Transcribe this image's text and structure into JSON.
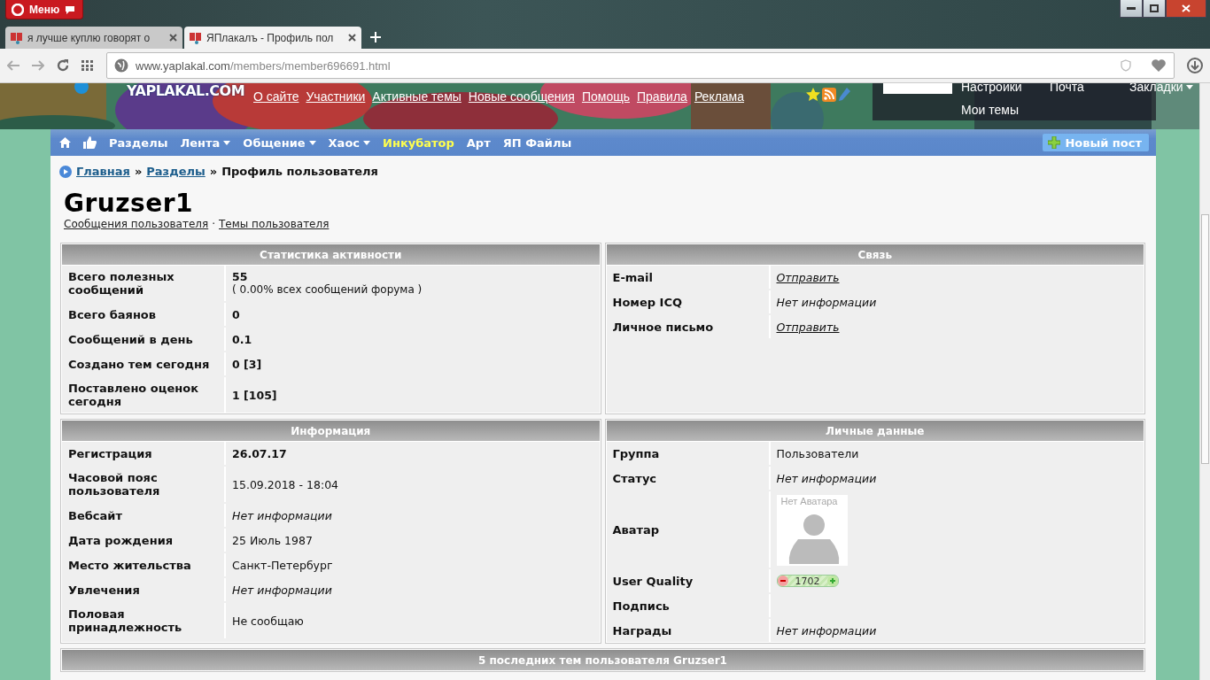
{
  "browser": {
    "menu": "Меню",
    "tabs": [
      {
        "title": "я лучше куплю говорят о",
        "selected": false
      },
      {
        "title": "ЯПлакалъ - Профиль пол",
        "selected": true
      }
    ],
    "url": {
      "host": "www.yaplakal.com",
      "path": "/members/member696691.html"
    }
  },
  "header": {
    "logo": "YAPLAKAL.COM",
    "links": [
      "О сайте",
      "Участники",
      "Активные темы",
      "Новые сообщения",
      "Помощь",
      "Правила",
      "Реклама"
    ],
    "user_menu": [
      {
        "label": "Настройки",
        "dropdown": false
      },
      {
        "label": "Почта",
        "dropdown": false
      },
      {
        "label": "Закладки",
        "dropdown": true
      },
      {
        "label": "Мои темы",
        "dropdown": false
      }
    ]
  },
  "nav": {
    "items": [
      {
        "label": "Разделы",
        "dropdown": false,
        "highlighted": false
      },
      {
        "label": "Лента",
        "dropdown": true,
        "highlighted": false
      },
      {
        "label": "Общение",
        "dropdown": true,
        "highlighted": false
      },
      {
        "label": "Хаос",
        "dropdown": true,
        "highlighted": false
      },
      {
        "label": "Инкубатор",
        "dropdown": false,
        "highlighted": true
      },
      {
        "label": "Арт",
        "dropdown": false,
        "highlighted": false
      },
      {
        "label": "ЯП Файлы",
        "dropdown": false,
        "highlighted": false
      }
    ],
    "new_post": "Новый пост"
  },
  "breadcrumb_separator": "»",
  "breadcrumb": [
    {
      "label": "Главная",
      "kind": "link"
    },
    {
      "label": "Разделы",
      "kind": "link"
    },
    {
      "label": "Профиль пользователя",
      "kind": "current"
    }
  ],
  "profile": {
    "username": "Gruzser1",
    "links": [
      "Сообщения пользователя",
      "Темы пользователя"
    ],
    "separator": "·"
  },
  "panels": [
    {
      "title": "Статистика активности",
      "rows": [
        {
          "label": "Всего полезных сообщений",
          "kind": "bold",
          "value": "55",
          "note": "( 0.00% всех сообщений форума )"
        },
        {
          "label": "Всего баянов",
          "kind": "bold",
          "value": "0"
        },
        {
          "label": "Сообщений в день",
          "kind": "bold",
          "value": "0.1"
        },
        {
          "label": "Создано тем сегодня",
          "kind": "bold",
          "value": "0 [3]"
        },
        {
          "label": "Поставлено оценок сегодня",
          "kind": "bold",
          "value": "1 [105]"
        }
      ]
    },
    {
      "title": "Связь",
      "rows": [
        {
          "label": "E-mail",
          "kind": "link",
          "value": "Отправить"
        },
        {
          "label": "Номер ICQ",
          "kind": "italic",
          "value": "Нет информации"
        },
        {
          "label": "Личное письмо",
          "kind": "link",
          "value": "Отправить"
        }
      ]
    },
    {
      "title": "Информация",
      "rows": [
        {
          "label": "Регистрация",
          "kind": "bold",
          "value": "26.07.17"
        },
        {
          "label": "Часовой пояс пользователя",
          "kind": "plain",
          "value": "15.09.2018 - 18:04"
        },
        {
          "label": "Вебсайт",
          "kind": "italic",
          "value": "Нет информации"
        },
        {
          "label": "Дата рождения",
          "kind": "plain",
          "value": "25 Июль 1987"
        },
        {
          "label": "Место жительства",
          "kind": "plain",
          "value": "Санкт-Петербург"
        },
        {
          "label": "Увлечения",
          "kind": "italic",
          "value": "Нет информации"
        },
        {
          "label": "Половая принадлежность",
          "kind": "plain",
          "value": "Не сообщаю"
        }
      ]
    },
    {
      "title": "Личные данные",
      "rows": [
        {
          "label": "Группа",
          "kind": "plain",
          "value": "Пользователи"
        },
        {
          "label": "Статус",
          "kind": "italic",
          "value": "Нет информации"
        },
        {
          "label": "Аватар",
          "kind": "avatar",
          "value": "Нет Аватара"
        },
        {
          "label": "User Quality",
          "kind": "rating",
          "value": "1702"
        },
        {
          "label": "Подпись",
          "kind": "empty"
        },
        {
          "label": "Награды",
          "kind": "italic",
          "value": "Нет информации"
        }
      ]
    }
  ],
  "recent_topics": {
    "title": "5 последних тем пользователя Gruzser1"
  }
}
